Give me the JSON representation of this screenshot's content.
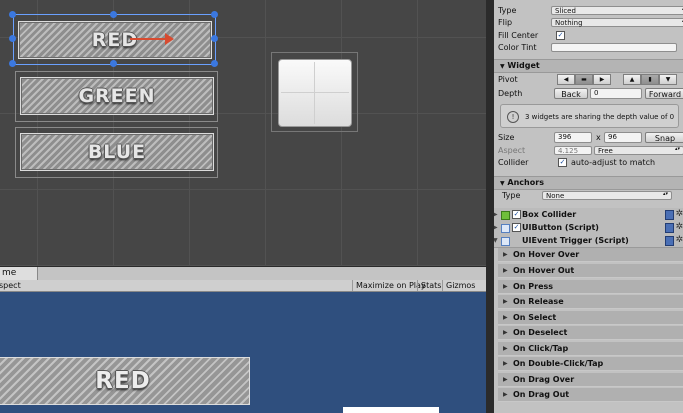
{
  "scene": {
    "buttons": [
      {
        "label": "RED"
      },
      {
        "label": "GREEN"
      },
      {
        "label": "BLUE"
      }
    ]
  },
  "game": {
    "tab_label": "me",
    "toolbar": {
      "aspect": "spect",
      "maximize": "Maximize on Play",
      "stats": "Stats",
      "gizmos": "Gizmos"
    },
    "button_label": "RED"
  },
  "inspector": {
    "sprite": {
      "type_label": "Type",
      "type_value": "Sliced",
      "flip_label": "Flip",
      "flip_value": "Nothing",
      "fill_center_label": "Fill Center",
      "fill_center_checked": true,
      "color_tint_label": "Color Tint",
      "color_tint_value": "#f4f4f4"
    },
    "widget": {
      "header": "Widget",
      "pivot_label": "Pivot",
      "depth_label": "Depth",
      "back_label": "Back",
      "depth_value": "0",
      "forward_label": "Forward",
      "info_text": "3 widgets are sharing the depth value of 0",
      "size_label": "Size",
      "size_w": "396",
      "size_x": "x",
      "size_h": "96",
      "snap_label": "Snap",
      "aspect_label": "Aspect",
      "aspect_value": "4.125",
      "aspect_mode": "Free",
      "collider_label": "Collider",
      "collider_checked": true,
      "collider_text": "auto-adjust to match"
    },
    "anchors": {
      "header": "Anchors",
      "type_label": "Type",
      "type_value": "None"
    },
    "components": [
      {
        "name": "Box Collider",
        "icon": "box-collider-icon"
      },
      {
        "name": "UIButton (Script)",
        "icon": "script-icon"
      },
      {
        "name": "UIEvent Trigger (Script)",
        "icon": "script-icon"
      }
    ],
    "events": [
      "On Hover Over",
      "On Hover Out",
      "On Press",
      "On Release",
      "On Select",
      "On Deselect",
      "On Click/Tap",
      "On Double-Click/Tap",
      "On Drag Over",
      "On Drag Out"
    ]
  }
}
